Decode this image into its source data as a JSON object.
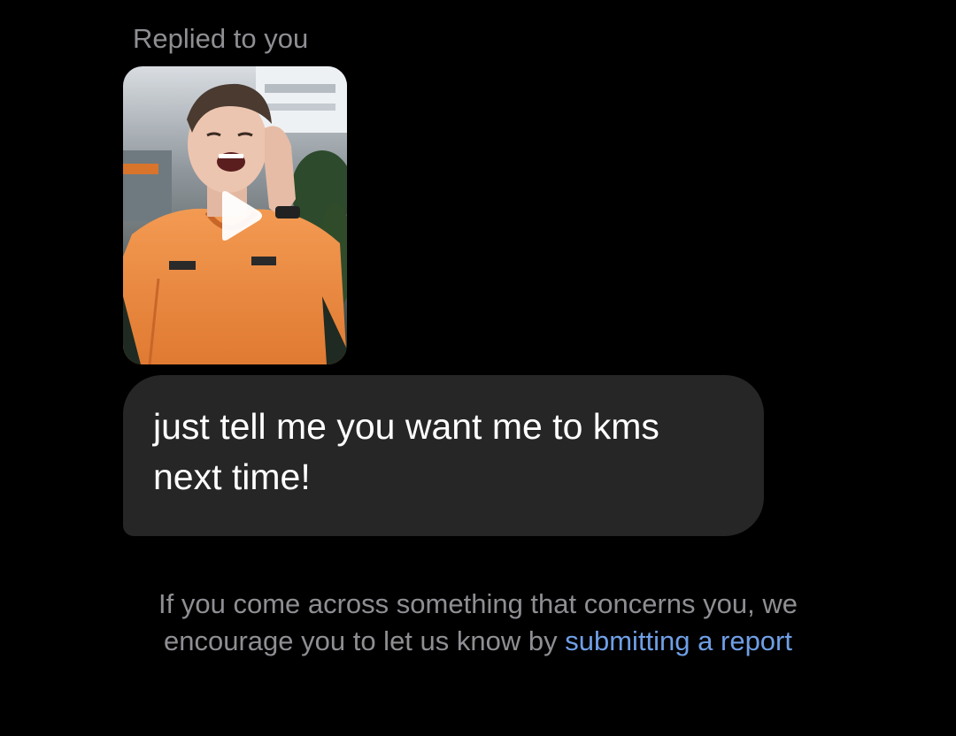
{
  "thread": {
    "reply_context_label": "Replied to you",
    "replied_media": {
      "kind": "video",
      "play_icon": "play-icon"
    },
    "message": {
      "text": "just tell me you want me to kms next time!"
    }
  },
  "footer": {
    "notice_text": "If you come across something that concerns you, we encourage you to let us know by",
    "report_link_label": "submitting a report"
  },
  "colors": {
    "background": "#000000",
    "bubble": "#262626",
    "muted_text": "#8e8e93",
    "link": "#6f9fe6",
    "message_text": "#ffffff"
  }
}
